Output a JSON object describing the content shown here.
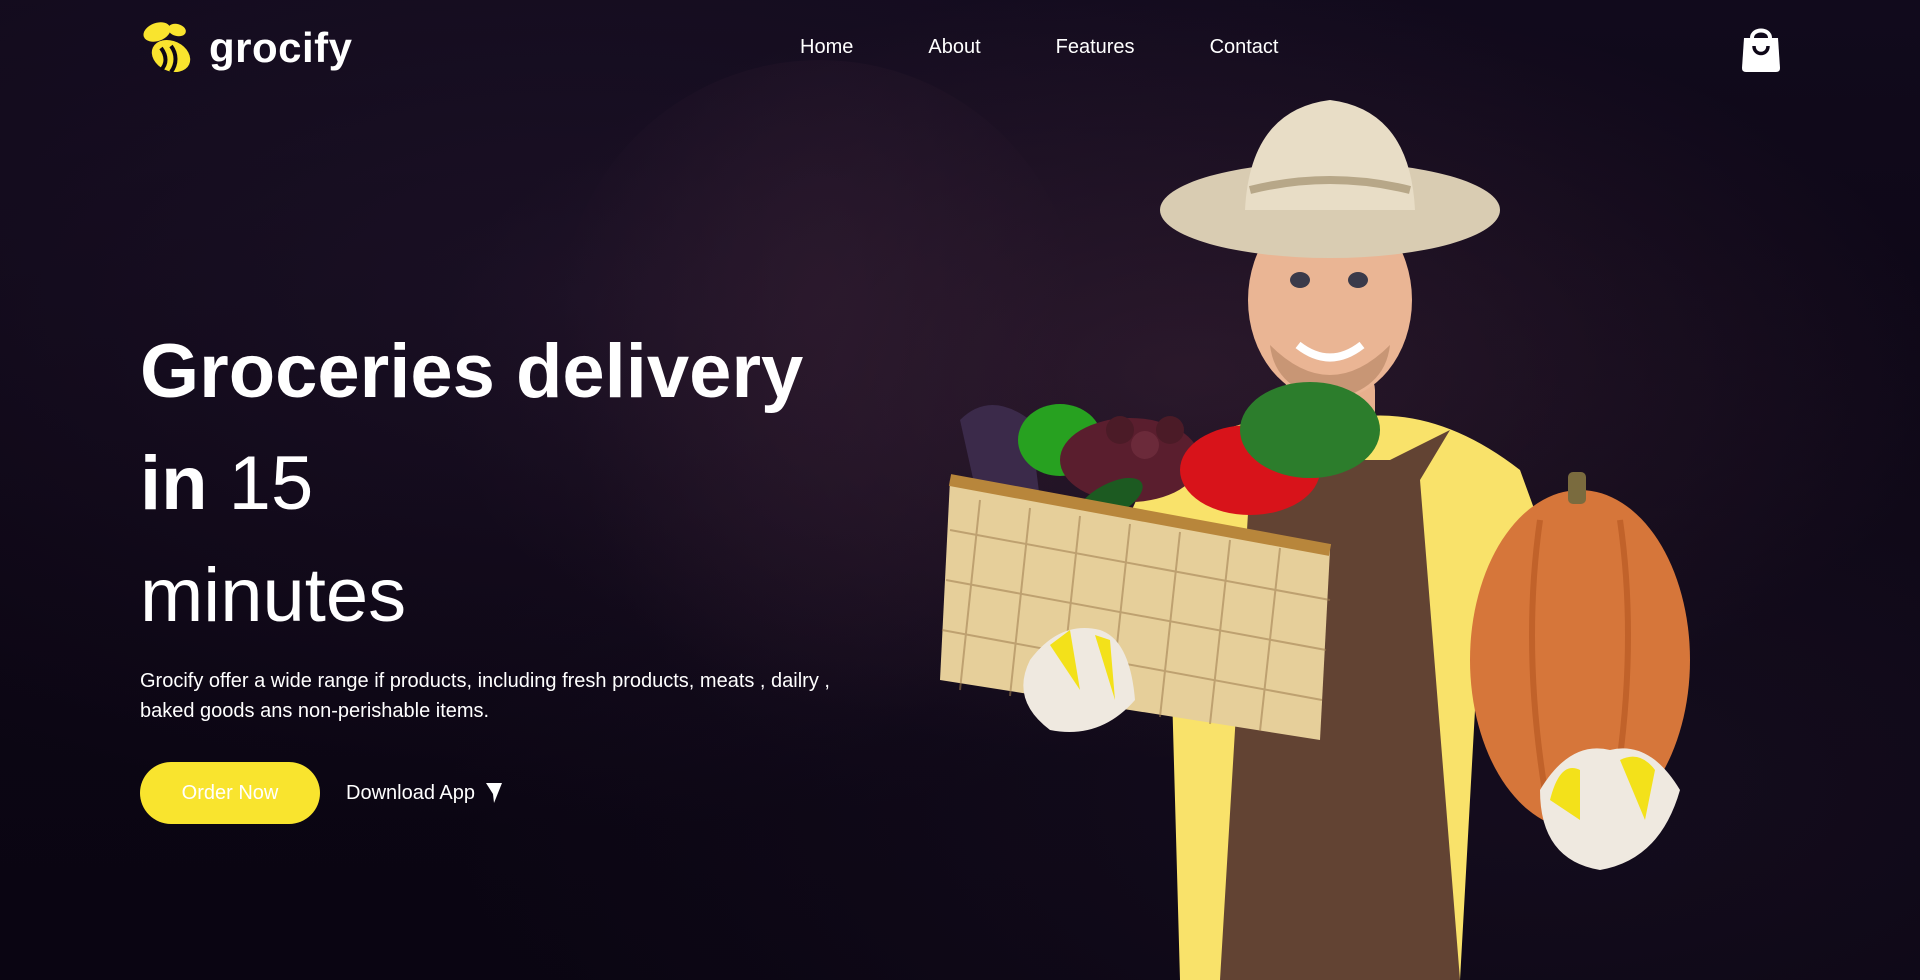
{
  "brand": {
    "name": "grocify",
    "accent_color": "#f9e42e"
  },
  "nav": {
    "items": [
      {
        "label": "Home"
      },
      {
        "label": "About"
      },
      {
        "label": "Features"
      },
      {
        "label": "Contact"
      }
    ],
    "cart_icon": "shopping-bag-icon"
  },
  "hero": {
    "headline_bold": "Groceries delivery in",
    "headline_light_1": "15",
    "headline_light_2": "minutes",
    "description": "Grocify offer a wide range if products, including fresh products, meats , dailry , baked goods ans non-perishable items.",
    "order_button": "Order Now",
    "download_link": "Download App",
    "download_icon": "cursor-arrow-icon"
  },
  "illustration": {
    "subject": "farmer-with-vegetable-basket",
    "colors": {
      "shirt": "#f9e26a",
      "apron": "#5a3a30",
      "hat": "#e8ddc6",
      "pumpkin": "#d6763a",
      "basket": "#e6cf9a",
      "glove_yellow": "#f3e11a",
      "pepper_red": "#d8131a"
    }
  }
}
